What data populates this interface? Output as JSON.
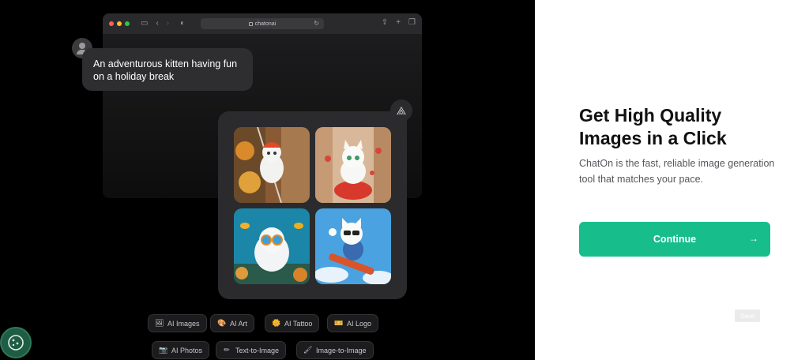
{
  "browser": {
    "address": "chatonai",
    "traffic_lights": [
      "#ff5f57",
      "#febc2e",
      "#28c840"
    ]
  },
  "chat": {
    "prompt": "An adventurous kitten having fun on a holiday break"
  },
  "images": [
    {
      "label": "kitten-climbing",
      "icon": "kitten-climbing-image"
    },
    {
      "label": "kitten-scooter",
      "icon": "kitten-scooter-image"
    },
    {
      "label": "kitten-underwater",
      "icon": "kitten-underwater-image"
    },
    {
      "label": "kitten-skateboard",
      "icon": "kitten-skateboard-image"
    }
  ],
  "chips_row1": [
    {
      "label": "AI Images",
      "icon": "🖼"
    },
    {
      "label": "AI Art",
      "icon": "🎨"
    },
    {
      "label": "AI Tattoo",
      "icon": "🌼"
    },
    {
      "label": "AI Logo",
      "icon": "🎫"
    }
  ],
  "chips_row2": [
    {
      "label": "AI Photos",
      "icon": "📷"
    },
    {
      "label": "Text-to-Image",
      "icon": "✏"
    },
    {
      "label": "Image-to-Image",
      "icon": "🖌"
    }
  ],
  "hero": {
    "title": "Get High Quality Images in a Click",
    "subtitle": "ChatOn is the fast, reliable image generation tool that matches your pace.",
    "cta": "Continue",
    "save": "Save"
  },
  "colors": {
    "accent": "#17bd8b",
    "dark_bg": "#000000"
  }
}
